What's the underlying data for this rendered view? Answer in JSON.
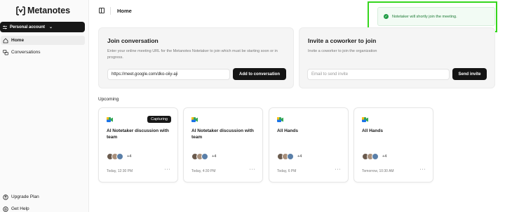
{
  "app": {
    "name": "Metanotes"
  },
  "sidebar": {
    "account_label": "Personal account",
    "items": [
      {
        "label": "Home",
        "icon": "home-icon",
        "active": true
      },
      {
        "label": "Conversations",
        "icon": "conversations-icon",
        "active": false
      }
    ],
    "footer": [
      {
        "label": "Upgrade Plan",
        "icon": "upgrade-icon"
      },
      {
        "label": "Get Help",
        "icon": "help-icon"
      }
    ]
  },
  "header": {
    "title": "Home"
  },
  "toast": {
    "message": "Notetaker will shortly join the meeting.",
    "icon": "check-circle-icon",
    "color": "#1f9d45"
  },
  "join": {
    "title": "Join conversation",
    "description": "Enter your online meeting URL for the Metanotes Notetaker to join which must be starting soon or in progress.",
    "url_value": "https://meet.google.com/dko-oiiy-aji",
    "button": "Add to conversation"
  },
  "invite": {
    "title": "Invite a coworker to join",
    "description": "Invite a coworker to join the organization",
    "email_placeholder": "Email to send invite",
    "button": "Send invite"
  },
  "upcoming": {
    "label": "Upcoming",
    "meetings": [
      {
        "title": "AI Notetaker discussion with team",
        "badge": "Capturing",
        "extra": "+4",
        "time": "Today, 12:30 PM"
      },
      {
        "title": "AI Notetaker discussion with team",
        "badge": "",
        "extra": "+4",
        "time": "Today, 4:30 PM"
      },
      {
        "title": "All Hands",
        "badge": "",
        "extra": "+4",
        "time": "Today, 6 PM"
      },
      {
        "title": "All Hands",
        "badge": "",
        "extra": "+4",
        "time": "Tomorrow, 10:30 AM"
      }
    ]
  },
  "colors": {
    "accent_dark": "#141414",
    "toast_outline": "#35d61d"
  }
}
